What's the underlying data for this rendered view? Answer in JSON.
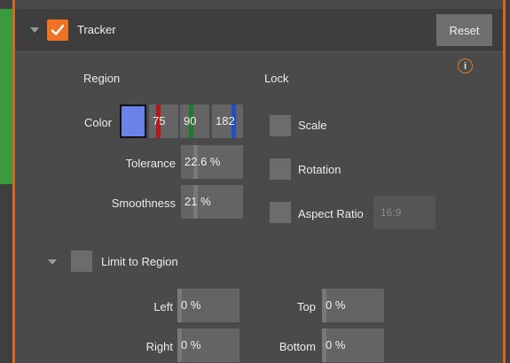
{
  "header": {
    "title": "Tracker",
    "reset_label": "Reset",
    "info_glyph": "i"
  },
  "region": {
    "heading": "Region",
    "color_label": "Color",
    "swatch_color": "#6b82e8",
    "red_value": "75",
    "green_value": "90",
    "blue_value": "182",
    "tolerance_label": "Tolerance",
    "tolerance_value": "22.6 %",
    "smoothness_label": "Smoothness",
    "smoothness_value": "21 %"
  },
  "lock": {
    "heading": "Lock",
    "scale_label": "Scale",
    "rotation_label": "Rotation",
    "aspect_label": "Aspect Ratio",
    "aspect_value": "16:9"
  },
  "limit": {
    "label": "Limit to Region",
    "left_label": "Left",
    "left_value": "0 %",
    "right_label": "Right",
    "right_value": "0 %",
    "top_label": "Top",
    "top_value": "0 %",
    "bottom_label": "Bottom",
    "bottom_value": "0 %"
  },
  "colors": {
    "accent": "#ef7322",
    "red_bar": "#b11b1b",
    "green_bar": "#1f7a2c",
    "blue_bar": "#1d4fc8"
  }
}
